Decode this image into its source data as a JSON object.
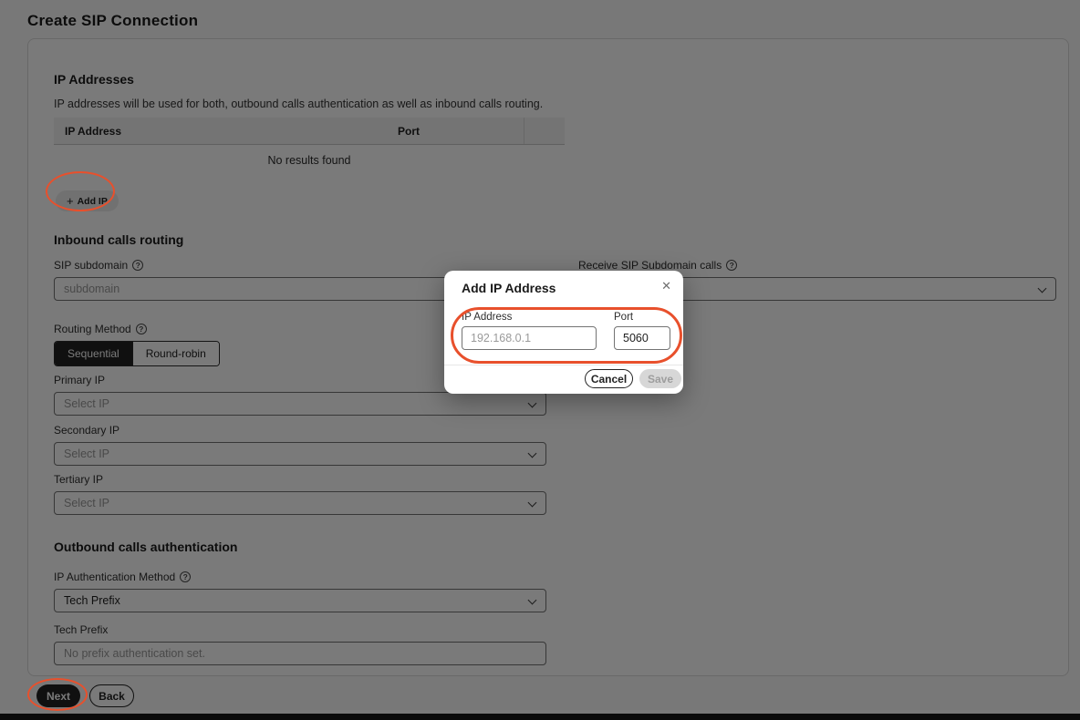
{
  "page": {
    "title": "Create SIP Connection"
  },
  "colors": {
    "annotation": "#e8502c",
    "overlay": "rgba(0,0,0,0.52)",
    "primary_button": "#232323"
  },
  "icons": {
    "help_glyph": "?",
    "plus_glyph": "+",
    "close_glyph": "✕"
  },
  "ip_section": {
    "heading": "IP Addresses",
    "description": "IP addresses will be used for both, outbound calls authentication as well as inbound calls routing.",
    "table": {
      "columns": [
        "IP Address",
        "Port"
      ],
      "empty_message": "No results found",
      "rows": []
    },
    "add_ip_label": "Add IP"
  },
  "inbound_section": {
    "heading": "Inbound calls routing",
    "sip_subdomain": {
      "label": "SIP subdomain",
      "placeholder": "subdomain"
    },
    "receive_subdomain": {
      "label": "Receive SIP Subdomain calls"
    },
    "routing_method": {
      "label": "Routing Method",
      "options": [
        "Sequential",
        "Round-robin"
      ],
      "selected": "Sequential"
    },
    "primary_ip": {
      "label": "Primary IP",
      "placeholder": "Select IP"
    },
    "secondary_ip": {
      "label": "Secondary IP",
      "placeholder": "Select IP"
    },
    "tertiary_ip": {
      "label": "Tertiary IP",
      "placeholder": "Select IP"
    }
  },
  "outbound_section": {
    "heading": "Outbound calls authentication",
    "ip_auth_method": {
      "label": "IP Authentication Method",
      "value": "Tech Prefix"
    },
    "tech_prefix": {
      "label": "Tech Prefix",
      "placeholder": "No prefix authentication set."
    }
  },
  "footer": {
    "next_label": "Next",
    "back_label": "Back"
  },
  "modal": {
    "title": "Add IP Address",
    "ip_address": {
      "label": "IP Address",
      "placeholder": "192.168.0.1"
    },
    "port": {
      "label": "Port",
      "value": "5060"
    },
    "cancel_label": "Cancel",
    "save_label": "Save",
    "save_disabled": true
  }
}
